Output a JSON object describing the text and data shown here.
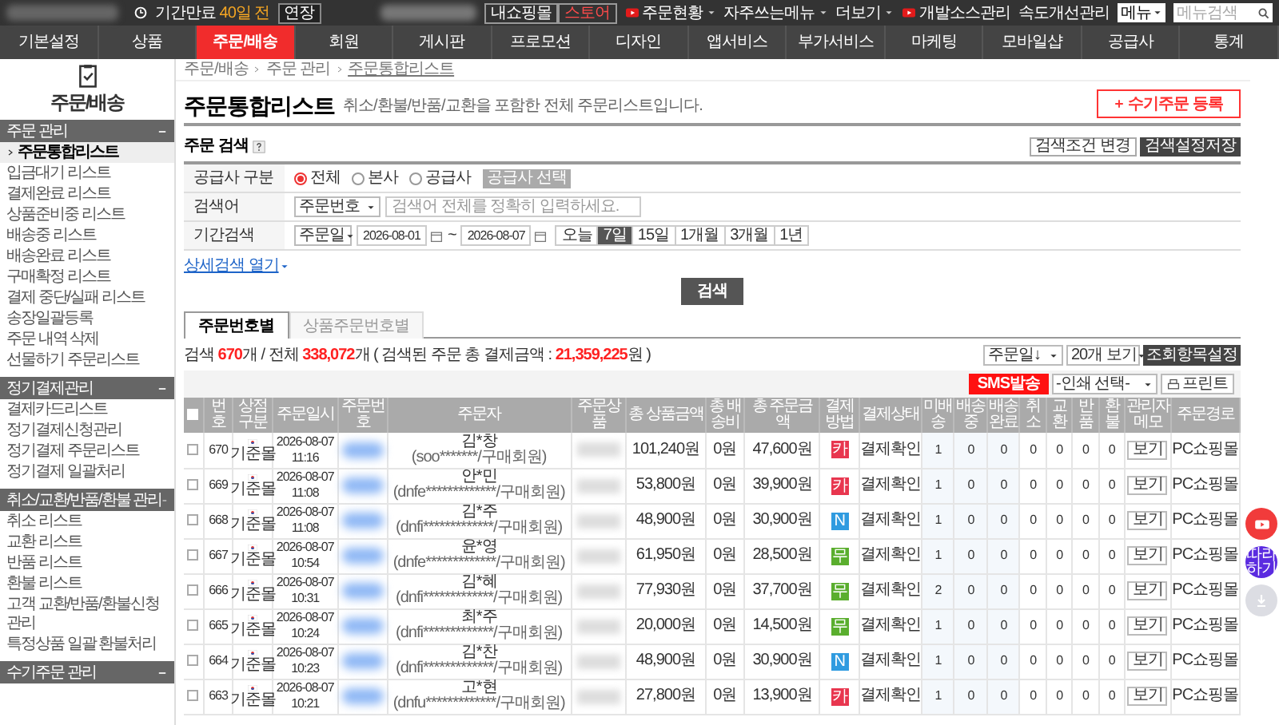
{
  "top_bar": {
    "expiry_label": "기간만료",
    "expiry_days": "40일 전",
    "extend_button": "연장",
    "shop_buttons": [
      "내쇼핑몰",
      "스토어"
    ],
    "links": [
      {
        "label": "주문현황",
        "kind": "video",
        "dropdown": true
      },
      {
        "label": "자주쓰는메뉴",
        "kind": "plain",
        "dropdown": true
      },
      {
        "label": "더보기",
        "kind": "plain",
        "dropdown": true
      },
      {
        "label": "개발소스관리",
        "kind": "video",
        "dropdown": false
      },
      {
        "label": "속도개선관리",
        "kind": "plain",
        "dropdown": false
      }
    ],
    "menu_select": "메뉴",
    "search_placeholder": "메뉴검색"
  },
  "nav": [
    {
      "label": "기본설정",
      "selected": false
    },
    {
      "label": "상품",
      "selected": false
    },
    {
      "label": "주문/배송",
      "selected": true
    },
    {
      "label": "회원",
      "selected": false
    },
    {
      "label": "게시판",
      "selected": false
    },
    {
      "label": "프로모션",
      "selected": false
    },
    {
      "label": "디자인",
      "selected": false
    },
    {
      "label": "앱서비스",
      "selected": false
    },
    {
      "label": "부가서비스",
      "selected": false
    },
    {
      "label": "마케팅",
      "selected": false
    },
    {
      "label": "모바일샵",
      "selected": false
    },
    {
      "label": "공급사",
      "selected": false
    },
    {
      "label": "통계",
      "selected": false
    }
  ],
  "sidebar": {
    "title": "주문/배송",
    "groups": [
      {
        "title": "주문 관리",
        "expanded": true,
        "items": [
          {
            "label": "주문통합리스트",
            "selected": true
          },
          {
            "label": "입금대기 리스트",
            "selected": false
          },
          {
            "label": "결제완료 리스트",
            "selected": false
          },
          {
            "label": "상품준비중 리스트",
            "selected": false
          },
          {
            "label": "배송중 리스트",
            "selected": false
          },
          {
            "label": "배송완료 리스트",
            "selected": false
          },
          {
            "label": "구매확정 리스트",
            "selected": false
          },
          {
            "label": "결제 중단/실패 리스트",
            "selected": false
          },
          {
            "label": "송장일괄등록",
            "selected": false
          },
          {
            "label": "주문 내역 삭제",
            "selected": false
          },
          {
            "label": "선물하기 주문리스트",
            "selected": false
          }
        ]
      },
      {
        "title": "정기결제관리",
        "expanded": true,
        "items": [
          {
            "label": "결제카드리스트",
            "selected": false
          },
          {
            "label": "정기결제신청관리",
            "selected": false
          },
          {
            "label": "정기결제 주문리스트",
            "selected": false
          },
          {
            "label": "정기결제 일괄처리",
            "selected": false
          }
        ]
      },
      {
        "title": "취소/교환/반품/환불 관리",
        "expanded": true,
        "items": [
          {
            "label": "취소 리스트",
            "selected": false
          },
          {
            "label": "교환 리스트",
            "selected": false
          },
          {
            "label": "반품 리스트",
            "selected": false
          },
          {
            "label": "환불 리스트",
            "selected": false
          },
          {
            "label": "고객 교환/반품/환불신청 관리",
            "selected": false
          },
          {
            "label": "특정상품 일괄 환불처리",
            "selected": false
          }
        ]
      },
      {
        "title": "수기주문 관리",
        "expanded": true
      }
    ]
  },
  "breadcrumb": [
    "주문/배송",
    "주문 관리",
    "주문통합리스트"
  ],
  "page": {
    "title": "주문통합리스트",
    "description": "취소/환불/반품/교환을 포함한 전체 주문리스트입니다.",
    "add_button": "수기주문 등록"
  },
  "search": {
    "title": "주문 검색",
    "buttons": [
      "검색조건 변경",
      "검색설정저장"
    ],
    "supplier": {
      "label": "공급사 구분",
      "options": [
        {
          "label": "전체",
          "selected": true
        },
        {
          "label": "본사",
          "selected": false
        },
        {
          "label": "공급사",
          "selected": false
        }
      ],
      "button": "공급사 선택"
    },
    "keyword": {
      "label": "검색어",
      "select": "주문번호",
      "placeholder": "검색어 전체를 정확히 입력하세요."
    },
    "period": {
      "label": "기간검색",
      "select": "주문일",
      "from": "2026-08-01",
      "separator": "~",
      "to": "2026-08-07",
      "ranges": [
        {
          "label": "오늘",
          "selected": false
        },
        {
          "label": "7일",
          "selected": true
        },
        {
          "label": "15일",
          "selected": false
        },
        {
          "label": "1개월",
          "selected": false
        },
        {
          "label": "3개월",
          "selected": false
        },
        {
          "label": "1년",
          "selected": false
        }
      ]
    },
    "detail_link": "상세검색 열기",
    "submit": "검색"
  },
  "tabs": [
    {
      "label": "주문번호별",
      "selected": true
    },
    {
      "label": "상품주문번호별",
      "selected": false
    }
  ],
  "summary": [
    {
      "text": "검색 ",
      "highlight": false
    },
    {
      "text": "670",
      "highlight": true
    },
    {
      "text": "개 / 전체 ",
      "highlight": false
    },
    {
      "text": "338,072",
      "highlight": true
    },
    {
      "text": "개 ( 검색된 주문 총 결제금액 : ",
      "highlight": false
    },
    {
      "text": "21,359,225",
      "highlight": true
    },
    {
      "text": "원 )",
      "highlight": false
    }
  ],
  "list_controls": {
    "sort": "주문일↓",
    "page_size": "20개 보기",
    "settings_button": "조회항목설정",
    "sms_button": "SMS발송",
    "print_select": "-인쇄 선택-",
    "print_button": "프린트"
  },
  "table": {
    "header_checked": false,
    "columns": [
      "번호",
      "상점구분",
      "주문일시",
      "주문번호",
      "주문자",
      "주문상품",
      "총 상품금액",
      "총 배송비",
      "총 주문금액",
      "결제방법",
      "결제상태",
      "미배송",
      "배송중",
      "배송완료",
      "취소",
      "교환",
      "반품",
      "환불",
      "관리자메모",
      "주문경로"
    ],
    "rows": [
      {
        "checked": false,
        "no": "670",
        "shop": "기준몰",
        "date": "2026-08-07",
        "time": "11:16",
        "name": "김*창",
        "id": "(soo*******/구매회원)",
        "goods": "101,240원",
        "shipping": "0원",
        "total": "47,600원",
        "pay": "카",
        "color": "#e8364f",
        "status": "결제확인",
        "counts": [
          "1",
          "0",
          "0",
          "0",
          "0",
          "0",
          "0"
        ],
        "memo": "보기",
        "route": "PC쇼핑몰"
      },
      {
        "checked": false,
        "no": "669",
        "shop": "기준몰",
        "date": "2026-08-07",
        "time": "11:08",
        "name": "안*민",
        "id": "(dnfe*************/구매회원)",
        "goods": "53,800원",
        "shipping": "0원",
        "total": "39,900원",
        "pay": "카",
        "color": "#e8364f",
        "status": "결제확인",
        "counts": [
          "1",
          "0",
          "0",
          "0",
          "0",
          "0",
          "0"
        ],
        "memo": "보기",
        "route": "PC쇼핑몰"
      },
      {
        "checked": false,
        "no": "668",
        "shop": "기준몰",
        "date": "2026-08-07",
        "time": "11:08",
        "name": "김*주",
        "id": "(dnfi*************/구매회원)",
        "goods": "48,900원",
        "shipping": "0원",
        "total": "30,900원",
        "pay": "N",
        "color": "#2f9be0",
        "status": "결제확인",
        "counts": [
          "1",
          "0",
          "0",
          "0",
          "0",
          "0",
          "0"
        ],
        "memo": "보기",
        "route": "PC쇼핑몰"
      },
      {
        "checked": false,
        "no": "667",
        "shop": "기준몰",
        "date": "2026-08-07",
        "time": "10:54",
        "name": "윤*영",
        "id": "(dnfe*************/구매회원)",
        "goods": "61,950원",
        "shipping": "0원",
        "total": "28,500원",
        "pay": "무",
        "color": "#5aae2e",
        "status": "결제확인",
        "counts": [
          "1",
          "0",
          "0",
          "0",
          "0",
          "0",
          "0"
        ],
        "memo": "보기",
        "route": "PC쇼핑몰"
      },
      {
        "checked": false,
        "no": "666",
        "shop": "기준몰",
        "date": "2026-08-07",
        "time": "10:31",
        "name": "김*혜",
        "id": "(dnfi*************/구매회원)",
        "goods": "77,930원",
        "shipping": "0원",
        "total": "37,700원",
        "pay": "무",
        "color": "#5aae2e",
        "status": "결제확인",
        "counts": [
          "2",
          "0",
          "0",
          "0",
          "0",
          "0",
          "0"
        ],
        "memo": "보기",
        "route": "PC쇼핑몰"
      },
      {
        "checked": false,
        "no": "665",
        "shop": "기준몰",
        "date": "2026-08-07",
        "time": "10:24",
        "name": "최*주",
        "id": "(dnfi*************/구매회원)",
        "goods": "20,000원",
        "shipping": "0원",
        "total": "14,500원",
        "pay": "무",
        "color": "#5aae2e",
        "status": "결제확인",
        "counts": [
          "1",
          "0",
          "0",
          "0",
          "0",
          "0",
          "0"
        ],
        "memo": "보기",
        "route": "PC쇼핑몰"
      },
      {
        "checked": false,
        "no": "664",
        "shop": "기준몰",
        "date": "2026-08-07",
        "time": "10:23",
        "name": "김*찬",
        "id": "(dnfi*************/구매회원)",
        "goods": "48,900원",
        "shipping": "0원",
        "total": "30,900원",
        "pay": "N",
        "color": "#2f9be0",
        "status": "결제확인",
        "counts": [
          "1",
          "0",
          "0",
          "0",
          "0",
          "0",
          "0"
        ],
        "memo": "보기",
        "route": "PC쇼핑몰"
      },
      {
        "checked": false,
        "no": "663",
        "shop": "기준몰",
        "date": "2026-08-07",
        "time": "10:21",
        "name": "고*현",
        "id": "(dnfu*************/구매회원)",
        "goods": "27,800원",
        "shipping": "0원",
        "total": "13,900원",
        "pay": "카",
        "color": "#e8364f",
        "status": "결제확인",
        "counts": [
          "1",
          "0",
          "0",
          "0",
          "0",
          "0",
          "0"
        ],
        "memo": "보기",
        "route": "PC쇼핑몰"
      }
    ]
  },
  "floating": {
    "guide_button": "따라하기"
  }
}
